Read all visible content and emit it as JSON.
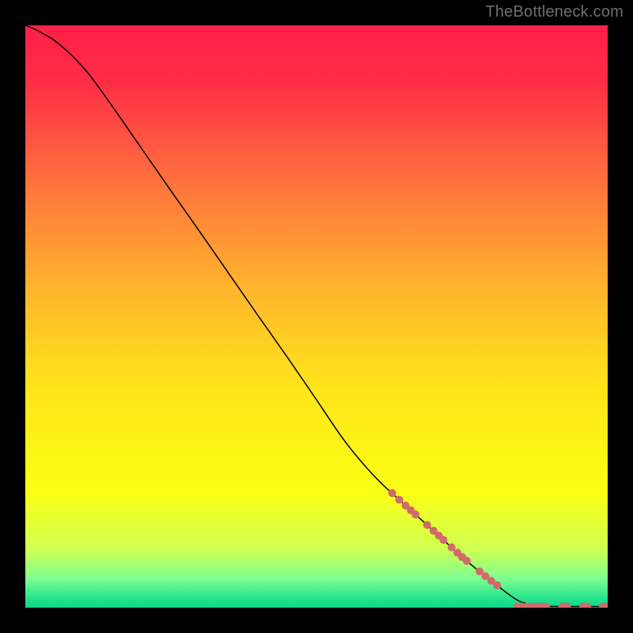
{
  "watermark": "TheBottleneck.com",
  "chart_data": {
    "type": "line",
    "title": "",
    "xlabel": "",
    "ylabel": "",
    "xlim": [
      0,
      100
    ],
    "ylim": [
      0,
      100
    ],
    "background": {
      "gradient_stops": [
        {
          "offset": 0.0,
          "color": "#ff1f47"
        },
        {
          "offset": 0.1,
          "color": "#ff2e46"
        },
        {
          "offset": 0.25,
          "color": "#ff6a3f"
        },
        {
          "offset": 0.45,
          "color": "#ffb42d"
        },
        {
          "offset": 0.62,
          "color": "#ffe41a"
        },
        {
          "offset": 0.8,
          "color": "#fbff12"
        },
        {
          "offset": 0.9,
          "color": "#cfff52"
        },
        {
          "offset": 0.95,
          "color": "#7fff90"
        },
        {
          "offset": 0.985,
          "color": "#23e28e"
        },
        {
          "offset": 1.0,
          "color": "#0fd488"
        }
      ]
    },
    "series": [
      {
        "name": "curve",
        "color": "#000000",
        "width": 1.5,
        "points": [
          {
            "x": 0.0,
            "y": 100.0
          },
          {
            "x": 1.5,
            "y": 99.4
          },
          {
            "x": 3.0,
            "y": 98.6
          },
          {
            "x": 5.0,
            "y": 97.4
          },
          {
            "x": 8.0,
            "y": 94.8
          },
          {
            "x": 11.0,
            "y": 91.5
          },
          {
            "x": 15.0,
            "y": 86.0
          },
          {
            "x": 20.0,
            "y": 78.8
          },
          {
            "x": 25.0,
            "y": 71.6
          },
          {
            "x": 30.0,
            "y": 64.5
          },
          {
            "x": 35.0,
            "y": 57.3
          },
          {
            "x": 40.0,
            "y": 50.1
          },
          {
            "x": 45.0,
            "y": 43.0
          },
          {
            "x": 50.0,
            "y": 35.7
          },
          {
            "x": 55.0,
            "y": 28.4
          },
          {
            "x": 60.0,
            "y": 22.5
          },
          {
            "x": 65.0,
            "y": 17.8
          },
          {
            "x": 70.0,
            "y": 13.3
          },
          {
            "x": 75.0,
            "y": 8.7
          },
          {
            "x": 80.0,
            "y": 4.6
          },
          {
            "x": 84.0,
            "y": 1.6
          },
          {
            "x": 86.0,
            "y": 0.7
          },
          {
            "x": 88.0,
            "y": 0.3
          },
          {
            "x": 92.0,
            "y": 0.2
          },
          {
            "x": 96.0,
            "y": 0.2
          },
          {
            "x": 100.0,
            "y": 0.2
          }
        ]
      }
    ],
    "markers": {
      "color": "#d26a6a",
      "radius_px": 5,
      "on_curve_x": [
        63.0,
        64.2,
        65.3,
        66.2,
        67.0,
        69.0,
        70.1,
        71.0,
        71.8,
        73.2,
        74.2,
        75.0,
        75.8,
        78.0,
        79.0,
        80.0,
        81.0
      ],
      "baseline_clusters": [
        [
          84.5,
          85.3,
          86.2,
          87.0,
          87.8,
          88.6,
          89.4
        ],
        [
          92.2,
          93.0
        ],
        [
          95.8,
          96.5
        ],
        [
          99.2,
          100.0
        ]
      ]
    }
  }
}
